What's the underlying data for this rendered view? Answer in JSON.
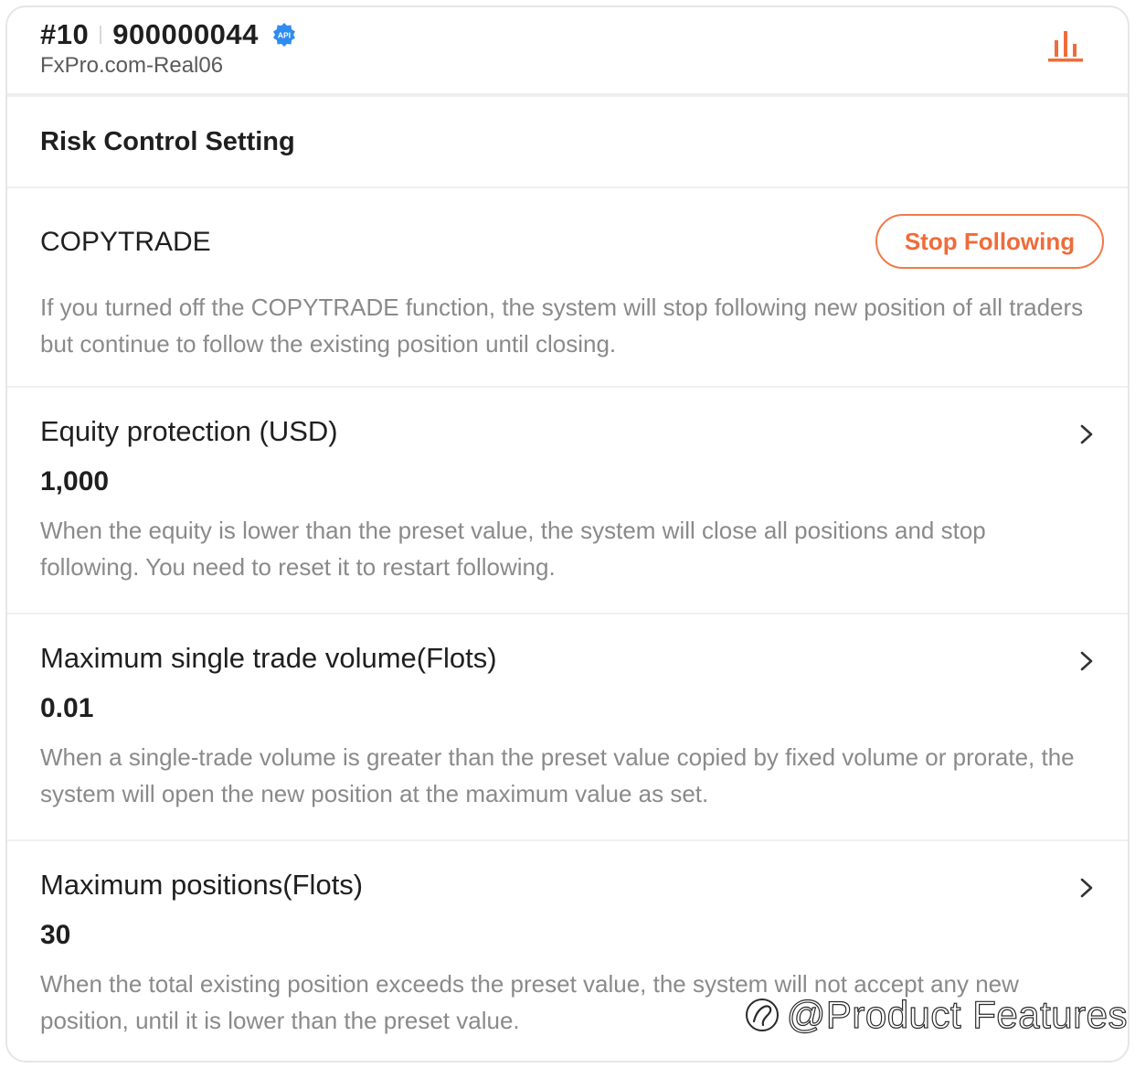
{
  "header": {
    "rank": "#10",
    "account_id": "900000044",
    "api_badge": "API",
    "server": "FxPro.com-Real06",
    "chart_icon": "bar-chart-icon",
    "accent_color": "#ef6c3a",
    "badge_color": "#2f8cf0"
  },
  "section": {
    "title": "Risk Control Setting"
  },
  "copytrade": {
    "label": "COPYTRADE",
    "button_label": "Stop Following",
    "description": "If you turned off the COPYTRADE function, the system will stop following new position of all traders but continue to follow the existing position until closing."
  },
  "settings": [
    {
      "label": "Equity protection (USD)",
      "value": "1,000",
      "description": "When the equity is lower than the preset value, the system will close all positions and stop following. You need to reset it to restart following.",
      "icon": "chevron-right-icon"
    },
    {
      "label": "Maximum single trade volume(Flots)",
      "value": "0.01",
      "description": "When a single-trade volume is greater than the preset value copied by fixed volume or prorate, the system will open the new position at the maximum value as set.",
      "icon": "chevron-right-icon"
    },
    {
      "label": "Maximum positions(Flots)",
      "value": "30",
      "description": "When the total existing position exceeds the preset value, the system will not accept any new position, until it is lower than the preset value.",
      "icon": "chevron-right-icon"
    }
  ],
  "watermark": {
    "text": "@Product Features"
  }
}
